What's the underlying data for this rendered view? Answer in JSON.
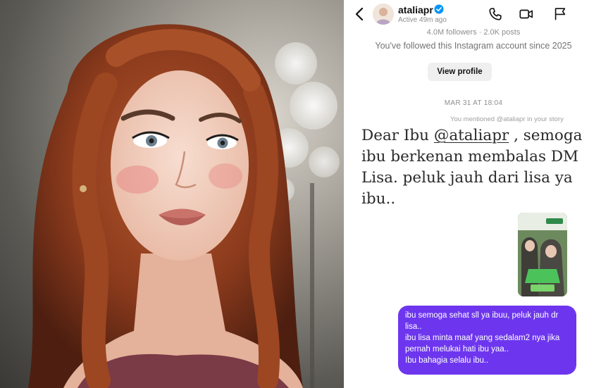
{
  "header": {
    "username": "ataliapr",
    "active_status": "Active 49m ago",
    "icons": [
      "back-icon",
      "verified-icon",
      "phone-icon",
      "video-icon",
      "flag-icon"
    ]
  },
  "profile": {
    "stats": "4.0M followers · 2.0K posts",
    "followed_since": "You've followed this Instagram account since 2025",
    "view_profile_label": "View profile"
  },
  "thread": {
    "date_label": "MAR 31 AT 18:04",
    "mention_notice": "You mentioned @ataliapr in your story",
    "story": {
      "line1_prefix": "Dear Ibu ",
      "handle": "@ataliapr",
      "line1_suffix": " , semoga",
      "line2": "ibu berkenan membalas DM",
      "line3": "Lisa. peluk jauh dari lisa ya",
      "line4": "ibu.."
    },
    "outgoing_message": [
      "ibu semoga sehat sll ya ibuu, peluk jauh dr lisa..",
      "ibu lisa minta maaf yang sedalam2 nya jika pernah melukai hati ibu yaa..",
      "Ibu bahagia selalu ibu.."
    ]
  },
  "colors": {
    "bubble": "#6d36ee",
    "verified": "#0095f6",
    "button_bg": "#efefef"
  }
}
